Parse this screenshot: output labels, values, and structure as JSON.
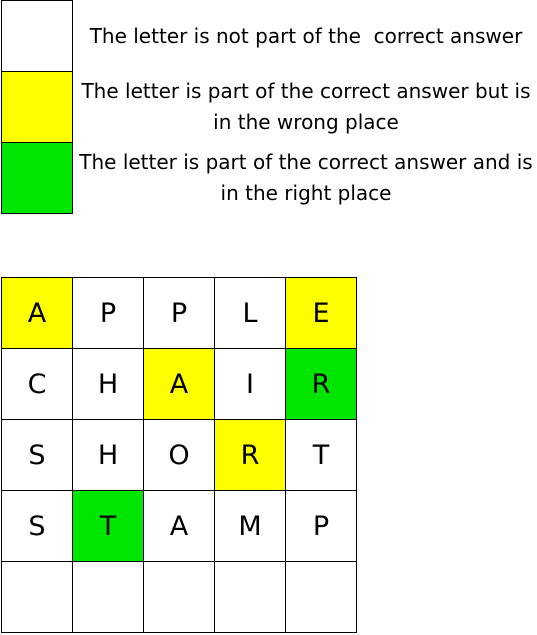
{
  "colors": {
    "absent": "#ffffff",
    "present": "#ffff00",
    "correct": "#00e600",
    "border": "#000000"
  },
  "legend": [
    {
      "state": "absent",
      "text": "The letter is not part of the  correct answer"
    },
    {
      "state": "present",
      "text": "The letter is part of the correct answer but is in the wrong place"
    },
    {
      "state": "correct",
      "text": "The letter is part of the correct answer and is in the right place"
    }
  ],
  "board": {
    "rows": [
      [
        {
          "letter": "A",
          "state": "present"
        },
        {
          "letter": "P",
          "state": "absent"
        },
        {
          "letter": "P",
          "state": "absent"
        },
        {
          "letter": "L",
          "state": "absent"
        },
        {
          "letter": "E",
          "state": "present"
        }
      ],
      [
        {
          "letter": "C",
          "state": "absent"
        },
        {
          "letter": "H",
          "state": "absent"
        },
        {
          "letter": "A",
          "state": "present"
        },
        {
          "letter": "I",
          "state": "absent"
        },
        {
          "letter": "R",
          "state": "correct"
        }
      ],
      [
        {
          "letter": "S",
          "state": "absent"
        },
        {
          "letter": "H",
          "state": "absent"
        },
        {
          "letter": "O",
          "state": "absent"
        },
        {
          "letter": "R",
          "state": "present"
        },
        {
          "letter": "T",
          "state": "absent"
        }
      ],
      [
        {
          "letter": "S",
          "state": "absent"
        },
        {
          "letter": "T",
          "state": "correct"
        },
        {
          "letter": "A",
          "state": "absent"
        },
        {
          "letter": "M",
          "state": "absent"
        },
        {
          "letter": "P",
          "state": "absent"
        }
      ],
      [
        {
          "letter": "",
          "state": "absent"
        },
        {
          "letter": "",
          "state": "absent"
        },
        {
          "letter": "",
          "state": "absent"
        },
        {
          "letter": "",
          "state": "absent"
        },
        {
          "letter": "",
          "state": "absent"
        }
      ]
    ]
  }
}
